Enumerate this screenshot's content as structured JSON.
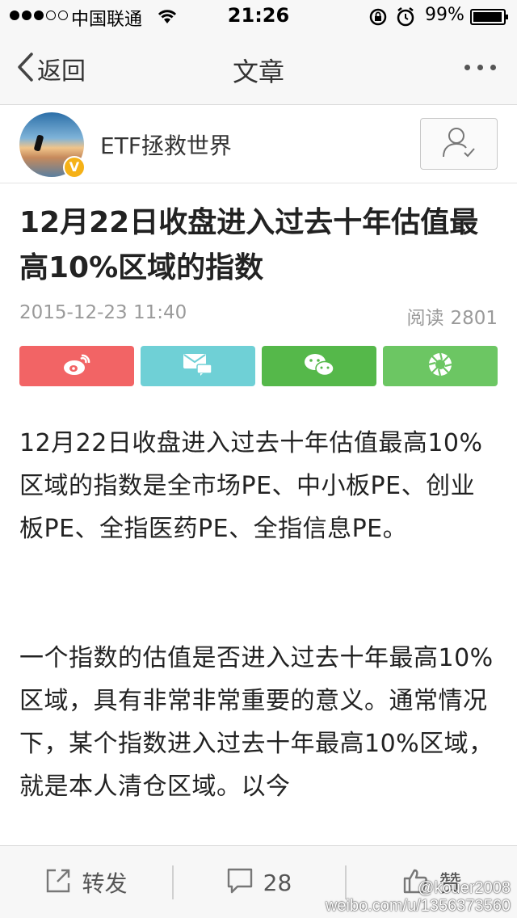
{
  "status_bar": {
    "carrier": "中国联通",
    "time": "21:26",
    "battery_percent": "99%",
    "signal_bars_filled": 3,
    "signal_bars_total": 5
  },
  "nav": {
    "back_label": "返回",
    "title": "文章"
  },
  "author": {
    "name": "ETF拯救世界",
    "verified_badge": "V"
  },
  "article": {
    "title": "12月22日收盘进入过去十年估值最高10%区域的指数",
    "date": "2015-12-23 11:40",
    "reads_label": "阅读",
    "reads_count": "2801",
    "paragraphs": [
      "12月22日收盘进入过去十年估值最高10%区域的指数是全市场PE、中小板PE、创业板PE、全指医药PE、全指信息PE。",
      "一个指数的估值是否进入过去十年最高10%区域，具有非常非常重要的意义。通常情况下，某个指数进入过去十年最高10%区域，就是本人清仓区域。以今"
    ]
  },
  "share": {
    "colors": {
      "weibo": "#f26465",
      "email": "#6fd0d6",
      "wechat": "#55b84a",
      "moments": "#6cc663"
    },
    "icons": [
      "weibo-icon",
      "mail-icon",
      "wechat-icon",
      "moments-icon"
    ]
  },
  "bottom_bar": {
    "repost_label": "转发",
    "comment_count": "28",
    "like_label": "赞"
  },
  "watermark": {
    "line1": "@kouer2008",
    "line2": "weibo.com/u/1356373560"
  }
}
